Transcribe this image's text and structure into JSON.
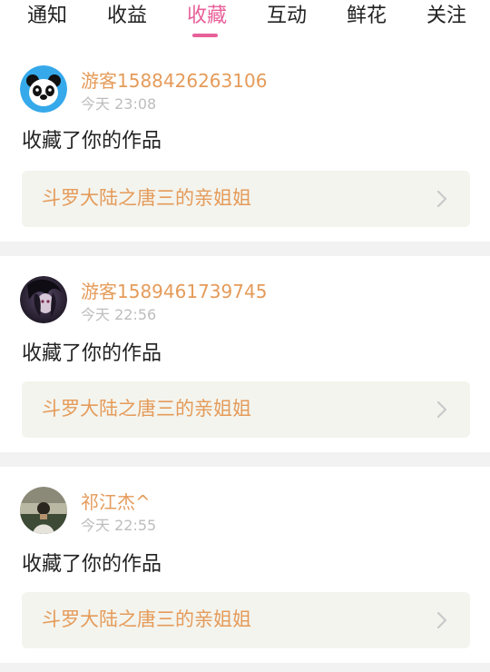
{
  "tabs": [
    {
      "label": "通知",
      "active": false
    },
    {
      "label": "收益",
      "active": false
    },
    {
      "label": "收藏",
      "active": true
    },
    {
      "label": "互动",
      "active": false
    },
    {
      "label": "鲜花",
      "active": false
    },
    {
      "label": "关注",
      "active": false
    }
  ],
  "colors": {
    "accent": "#e8609a",
    "username": "#e59b5a",
    "work_title": "#e59b5a",
    "time": "#bdbdbd",
    "card_bg": "#f3f4ee",
    "divider": "#f2f2f2"
  },
  "notifications": [
    {
      "username": "游客1588426263106",
      "time": "今天 23:08",
      "action": "收藏了你的作品",
      "work_title": "斗罗大陆之唐三的亲姐姐",
      "avatar_icon": "panda-avatar-icon",
      "chevron_icon": "chevron-right-icon"
    },
    {
      "username": "游客1589461739745",
      "time": "今天 22:56",
      "action": "收藏了你的作品",
      "work_title": "斗罗大陆之唐三的亲姐姐",
      "avatar_icon": "anime-avatar-icon",
      "chevron_icon": "chevron-right-icon"
    },
    {
      "username": "祁江杰^",
      "time": "今天 22:55",
      "action": "收藏了你的作品",
      "work_title": "斗罗大陆之唐三的亲姐姐",
      "avatar_icon": "photo-avatar-icon",
      "chevron_icon": "chevron-right-icon"
    }
  ]
}
